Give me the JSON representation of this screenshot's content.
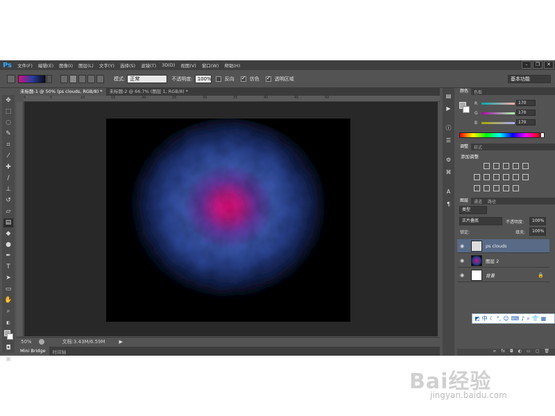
{
  "app": {
    "logo": "Ps"
  },
  "menu": [
    "文件(F)",
    "编辑(E)",
    "图像(I)",
    "图层(L)",
    "文字(Y)",
    "选择(S)",
    "滤镜(T)",
    "3D(D)",
    "视图(V)",
    "窗口(W)",
    "帮助(H)"
  ],
  "window_controls": [
    "–",
    "❐",
    "✕"
  ],
  "options": {
    "mode_label": "模式:",
    "mode_value": "正常",
    "opacity_label": "不透明度:",
    "opacity_value": "100%",
    "reverse_label": "反向",
    "dither_label": "仿色",
    "transparency_label": "透明区域",
    "workspace": "基本功能"
  },
  "doc_tabs": [
    "未标题-1 @ 50% (ps clouds, RGB/8) *",
    "未标题-2 @ 66.7% (图层 1, RGB/8) *"
  ],
  "ruler_ticks": [
    "5",
    "0",
    "5",
    "10",
    "15",
    "20",
    "25",
    "30",
    "35",
    "40",
    "45",
    "50"
  ],
  "status": {
    "zoom": "50%",
    "doc_size": "文档:3.43M/6.59M"
  },
  "bottom_tabs": [
    "Mini Bridge",
    "时间轴"
  ],
  "color_panel": {
    "tabs": [
      "颜色",
      "色板"
    ],
    "r_label": "R",
    "g_label": "G",
    "b_label": "B",
    "r": "170",
    "g": "170",
    "b": "170"
  },
  "adjust_panel": {
    "tabs": [
      "调整",
      "样式"
    ],
    "title": "添加调整"
  },
  "layers_panel": {
    "tabs": [
      "图层",
      "通道",
      "路径"
    ],
    "filter_kind": "类型",
    "blend_mode": "正片叠底",
    "opacity_label": "不透明度:",
    "opacity": "100%",
    "lock_label": "锁定:",
    "fill_label": "填充:",
    "fill": "100%",
    "layers": [
      {
        "name": "ps clouds",
        "selected": true
      },
      {
        "name": "图层 2",
        "selected": false
      },
      {
        "name": "背景",
        "selected": false
      }
    ]
  },
  "ime_toolbar": "中",
  "watermark": {
    "brand": "Bai经验",
    "url": "jingyan.baidu.com"
  }
}
